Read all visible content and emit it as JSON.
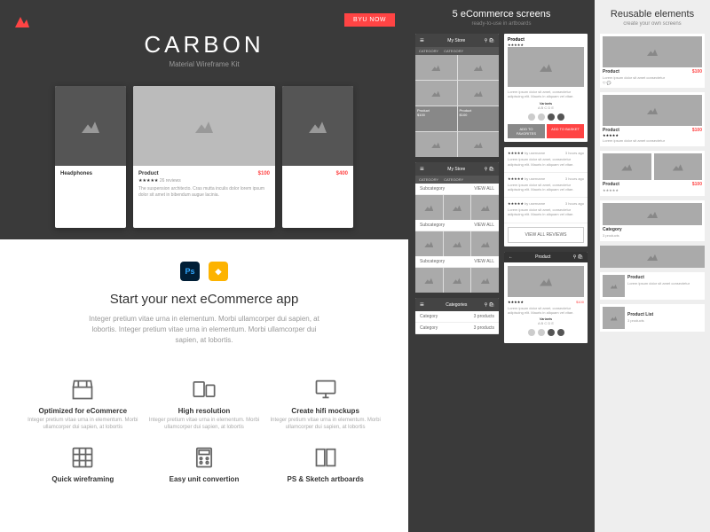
{
  "hero": {
    "buy": "BYU NOW",
    "title": "CARBON",
    "subtitle": "Material Wireframe Kit"
  },
  "mockups": {
    "left": {
      "name": "Headphones"
    },
    "center": {
      "name": "Product",
      "price": "$100",
      "stars": "★★★★★",
      "reviews": "26 reviews",
      "desc": "The suspension architecto. Cras mutta inculis dolor lorem ipsum dolor sit amet in bibendum augue lacinia."
    },
    "right": {
      "price": "$400"
    }
  },
  "intro": {
    "heading": "Start your next eCommerce app",
    "body": "Integer pretium vitae urna in elementum. Morbi ullamcorper dui sapien, at lobortis. Integer pretium vitae urna in elementum. Morbi ullamcorper dui sapien, at lobortis."
  },
  "features": [
    {
      "title": "Optimized for eCommerce",
      "desc": "Integer pretium vitae urna in elementum. Morbi ullamcorper dui sapien, at lobortis"
    },
    {
      "title": "High resolution",
      "desc": "Integer pretium vitae urna in elementum. Morbi ullamcorper dui sapien, at lobortis"
    },
    {
      "title": "Create hifi mockups",
      "desc": "Integer pretium vitae urna in elementum. Morbi ullamcorper dui sapien, at lobortis"
    },
    {
      "title": "Quick wireframing",
      "desc": ""
    },
    {
      "title": "Easy unit convertion",
      "desc": ""
    },
    {
      "title": "PS & Sketch artboards",
      "desc": ""
    }
  ],
  "midPanel": {
    "title": "5 eCommerce screens",
    "subtitle": "ready-to-use in artboards",
    "store": "My Store",
    "category": "CATEGORY",
    "product": "Product",
    "stars": "★★★★★",
    "lorem": "Lorem ipsum dolor sit amet, consectetur adipiscing elit. Mauris in aliquam vel vitae.",
    "variants": "Variants",
    "addFav": "ADD TO FAVORITES",
    "addBasket": "ADD TO BASKET",
    "subcategory": "Subcategory",
    "viewAll": "VIEW ALL",
    "viewReviews": "VIEW ALL REVIEWS",
    "categories": "Categories",
    "categoryItem": "Category",
    "productCount": "3 products",
    "price": "$100",
    "by": "by username",
    "ago": "3 hours ago"
  },
  "rightPanel": {
    "title": "Reusable elements",
    "subtitle": "create your own screens",
    "product": "Product",
    "price": "$100",
    "stars": "★★★★★",
    "desc": "Lorem ipsum dolor sit amet consectetur",
    "category": "Category",
    "count": "3 products",
    "productList": "Product List"
  }
}
